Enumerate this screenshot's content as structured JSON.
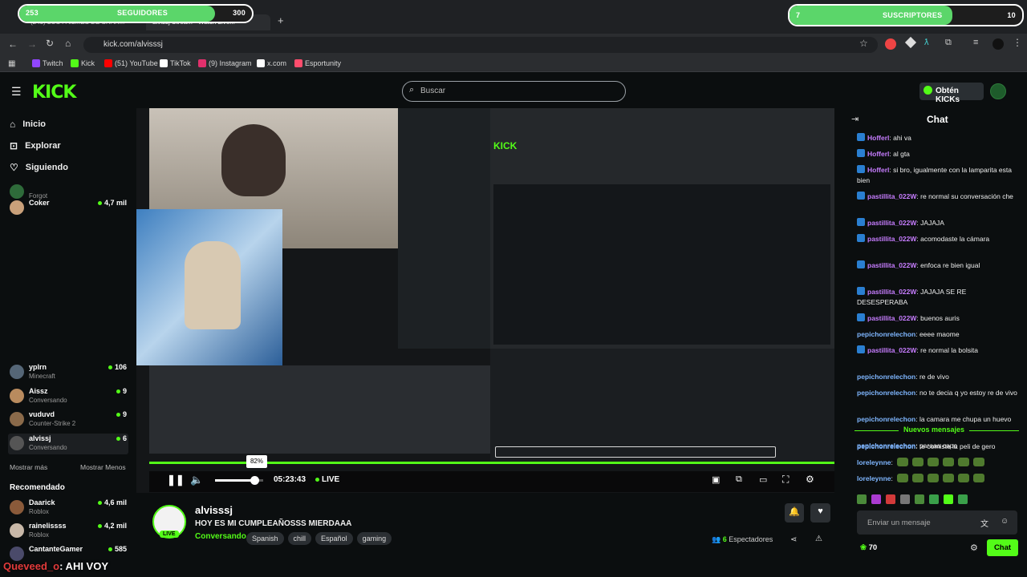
{
  "overlay": {
    "followers_count": "253",
    "followers_label": "SEGUIDORES",
    "followers_goal": "300",
    "followers_progress": 0.84,
    "subs_count": "7",
    "subs_label": "SUSCRIPTORES",
    "subs_goal": "10",
    "subs_progress": 0.7,
    "bottom_chat_user": "Queveed_o",
    "bottom_chat_text": ": AHI VOY"
  },
  "browser": {
    "tabs": [
      "(243) LOS FAIL...ES DE SHAR...",
      "alvissj Stream - Watch Live..."
    ],
    "url": "kick.com/alvisssj",
    "bookmarks": [
      {
        "label": "Twitch",
        "color": "#9146ff"
      },
      {
        "label": "Kick",
        "color": "#53fc18"
      },
      {
        "label": "(51) YouTube",
        "color": "#ff0000"
      },
      {
        "label": "TikTok",
        "color": "#ffffff"
      },
      {
        "label": "(9) Instagram",
        "color": "#e1306c"
      },
      {
        "label": "x.com",
        "color": "#ffffff"
      },
      {
        "label": "Esportunity",
        "color": "#ff4d6d"
      }
    ]
  },
  "kick": {
    "logo": "KICK",
    "search_placeholder": "Buscar",
    "kicks_button": "Obtén KICKs"
  },
  "sidebar": {
    "nav": [
      {
        "label": "Inicio",
        "icon": "home-icon"
      },
      {
        "label": "Explorar",
        "icon": "compass-icon"
      },
      {
        "label": "Siguiendo",
        "icon": "heart-icon"
      }
    ],
    "followed": [
      {
        "name": "",
        "category": "Forgot",
        "viewers": ""
      },
      {
        "name": "Coker",
        "category": "",
        "viewers": "4,7 mil"
      },
      {
        "name": "yplrn",
        "category": "Minecraft",
        "viewers": "106"
      },
      {
        "name": "Aissz",
        "category": "Conversando",
        "viewers": "9"
      },
      {
        "name": "vuduvd",
        "category": "Counter-Strike 2",
        "viewers": "9"
      },
      {
        "name": "alvissj",
        "category": "Conversando",
        "viewers": "6"
      }
    ],
    "show_more": "Mostrar más",
    "show_less": "Mostrar Menos",
    "recommended_title": "Recomendado",
    "recommended": [
      {
        "name": "Daarick",
        "category": "Roblox",
        "viewers": "4,6 mil"
      },
      {
        "name": "rainelissss",
        "category": "Roblox",
        "viewers": "4,2 mil"
      },
      {
        "name": "CantanteGamer",
        "category": "",
        "viewers": "585"
      }
    ]
  },
  "player": {
    "volume_tooltip": "82%",
    "volume_level": 0.82,
    "elapsed": "05:23:43",
    "live_label": "LIVE"
  },
  "stream": {
    "channel": "alvisssj",
    "title": "HOY ES MI CUMPLEAÑOSSS MIERDAAA",
    "category": "Conversando",
    "tags": [
      "Spanish",
      "chill",
      "Español",
      "gaming"
    ],
    "live_badge": "LIVE",
    "viewers_count": "6",
    "viewers_label": "Espectadores"
  },
  "chat": {
    "title": "Chat",
    "messages": [
      {
        "user": "Hofferl",
        "color": "#c77dff",
        "text": ": ahi va",
        "badge": true
      },
      {
        "user": "Hofferl",
        "color": "#c77dff",
        "text": ": al gta",
        "badge": true
      },
      {
        "user": "Hofferl",
        "color": "#c77dff",
        "text": ": si bro, igualmente con la lamparita esta bien",
        "badge": true
      },
      {
        "user": "pastillita_022W",
        "color": "#c77dff",
        "text": ": re normal su conversación che",
        "badge": true
      },
      {
        "user": "pastillita_022W",
        "color": "#c77dff",
        "text": ": JAJAJA",
        "badge": true
      },
      {
        "user": "pastillita_022W",
        "color": "#c77dff",
        "text": ": acomodaste la cámara",
        "badge": true
      },
      {
        "user": "pastillita_022W",
        "color": "#c77dff",
        "text": ": enfoca re bien igual",
        "badge": true
      },
      {
        "user": "pastillita_022W",
        "color": "#c77dff",
        "text": ": JAJAJA SE RE DESESPERABA",
        "badge": true
      },
      {
        "user": "pastillita_022W",
        "color": "#c77dff",
        "text": ": buenos auris",
        "badge": true
      },
      {
        "user": "pepichonrelechon",
        "color": "#7fb6ff",
        "text": ": eeee maome",
        "badge": false
      },
      {
        "user": "pastillita_022W",
        "color": "#c77dff",
        "text": ": re normal la bolsita",
        "badge": true
      },
      {
        "user": "pepichonrelechon",
        "color": "#7fb6ff",
        "text": ": re de vivo",
        "badge": false
      },
      {
        "user": "pepichonrelechon",
        "color": "#7fb6ff",
        "text": ": no te decia q yo estoy re de vivo",
        "badge": false
      },
      {
        "user": "pepichonrelechon",
        "color": "#7fb6ff",
        "text": ": la camara me chupa un huevo",
        "badge": false
      },
      {
        "user": "pepichonrelechon",
        "color": "#7fb6ff",
        "text": ": paraaa capo",
        "badge": false
      }
    ],
    "new_messages_label": "Nuevos mensajes",
    "new_messages": [
      {
        "user": "pepichonrelechon",
        "color": "#7fb6ff",
        "text": ": te comiste la peli de gero"
      },
      {
        "user": "loreleynne",
        "color": "#7fb6ff",
        "text": ":"
      },
      {
        "user": "loreleynne",
        "color": "#7fb6ff",
        "text": ":"
      }
    ],
    "input_placeholder": "Enviar un mensaje",
    "points": "70",
    "send_button": "Chat"
  },
  "colors": {
    "kick_green": "#53fc18",
    "background": "#0b0e0f",
    "overlay_green": "#5bd66a"
  }
}
